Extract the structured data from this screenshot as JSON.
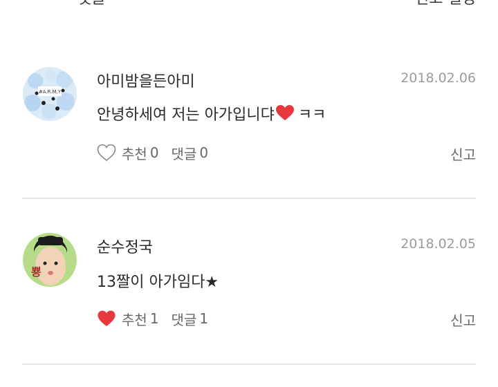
{
  "header": {
    "title": "댓글",
    "right_label": "신고 설정"
  },
  "comments": [
    {
      "nickname": "아미밤을든아미",
      "date": "2018.02.06",
      "text_before": "안녕하세여 저는 아가입니댜",
      "text_after": " ㅋㅋ",
      "avatar_text": "#A.R.M.Y",
      "recommend_label": "추천",
      "recommend_count": "0",
      "reply_label": "댓글",
      "reply_count": "0",
      "report_label": "신고",
      "liked": false
    },
    {
      "nickname": "순수정국",
      "date": "2018.02.05",
      "text": "13짤이 아가임다★",
      "avatar_text": "뿅",
      "recommend_label": "추천",
      "recommend_count": "1",
      "reply_label": "댓글",
      "reply_count": "1",
      "report_label": "신고",
      "liked": true
    }
  ],
  "colors": {
    "heart_red": "#e8373d",
    "divider": "#e8e8e8",
    "muted_text": "#9b9b9b"
  }
}
